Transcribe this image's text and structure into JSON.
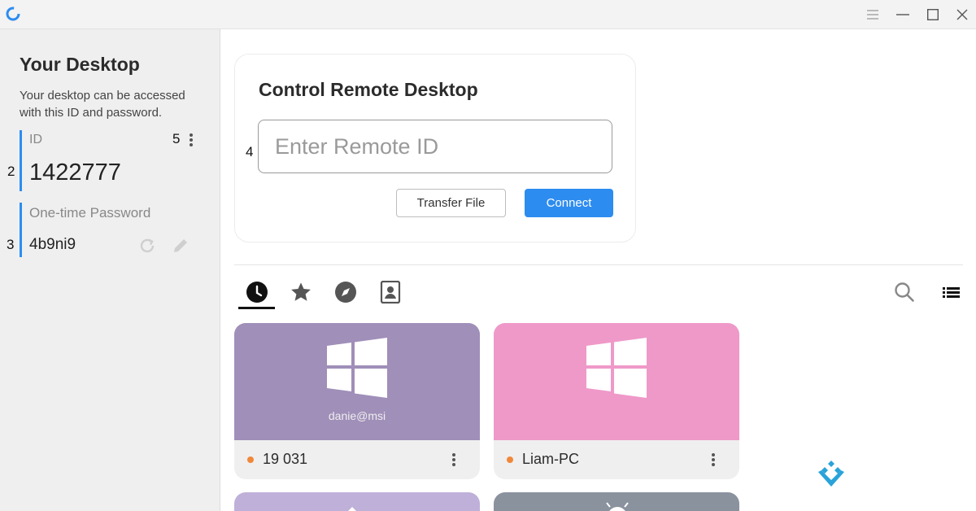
{
  "window": {
    "icons": [
      "app-logo-icon",
      "menu-icon",
      "minimize-icon",
      "maximize-icon",
      "close-icon"
    ]
  },
  "your_desktop": {
    "title": "Your Desktop",
    "description": "Your desktop can be accessed with this ID and password.",
    "id_label": "ID",
    "id_value": "1422777",
    "password_label": "One-time Password",
    "password_value": "4b9ni9",
    "accent_color": "#2d8cf0"
  },
  "annotations": {
    "m2": "2",
    "m3": "3",
    "m4": "4",
    "m5": "5"
  },
  "control": {
    "title": "Control Remote Desktop",
    "input_placeholder": "Enter Remote ID",
    "transfer_label": "Transfer File",
    "connect_label": "Connect",
    "connect_color": "#2d8cf0"
  },
  "tabs": [
    {
      "icon": "recent-clock-icon",
      "active": true
    },
    {
      "icon": "favorites-star-icon",
      "active": false
    },
    {
      "icon": "discovered-compass-icon",
      "active": false
    },
    {
      "icon": "address-book-icon",
      "active": false
    }
  ],
  "toolbar": {
    "icons": [
      "search-icon",
      "list-view-icon"
    ]
  },
  "peers": [
    {
      "name": "19 031",
      "username": "danie@msi",
      "os": "windows-icon",
      "color": "#a08fb9",
      "status_color": "#f0883a"
    },
    {
      "name": "Liam-PC",
      "username": "",
      "os": "windows-icon",
      "color": "#ef99c9",
      "status_color": "#f0883a"
    }
  ],
  "peers_partial": [
    {
      "color": "#bfb0d9"
    },
    {
      "color": "#8a929e"
    }
  ]
}
